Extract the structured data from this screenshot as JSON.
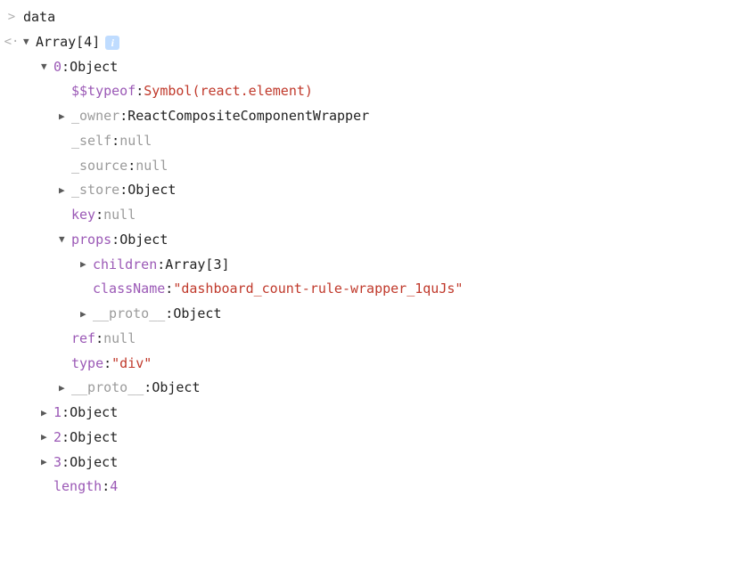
{
  "header": {
    "prompt": ">",
    "expr": "data"
  },
  "result_gutter": "<·",
  "info_badge": "i",
  "tree": {
    "root": {
      "key": "Array[4]"
    },
    "idx0": {
      "key": "0",
      "val": "Object",
      "typeof_key": "$$typeof",
      "typeof_val": "Symbol(react.element)",
      "owner_key": "_owner",
      "owner_val": "ReactCompositeComponentWrapper",
      "self_key": "_self",
      "self_val": "null",
      "source_key": "_source",
      "source_val": "null",
      "store_key": "_store",
      "store_val": "Object",
      "key_key": "key",
      "key_val": "null",
      "props_key": "props",
      "props_val": "Object",
      "props": {
        "children_key": "children",
        "children_val": "Array[3]",
        "className_key": "className",
        "className_val": "\"dashboard_count-rule-wrapper_1quJs\"",
        "proto_key": "__proto__",
        "proto_val": "Object"
      },
      "ref_key": "ref",
      "ref_val": "null",
      "type_key": "type",
      "type_val": "\"div\"",
      "proto_key": "__proto__",
      "proto_val": "Object"
    },
    "idx1": {
      "key": "1",
      "val": "Object"
    },
    "idx2": {
      "key": "2",
      "val": "Object"
    },
    "idx3": {
      "key": "3",
      "val": "Object"
    },
    "length": {
      "key": "length",
      "val": "4"
    }
  }
}
